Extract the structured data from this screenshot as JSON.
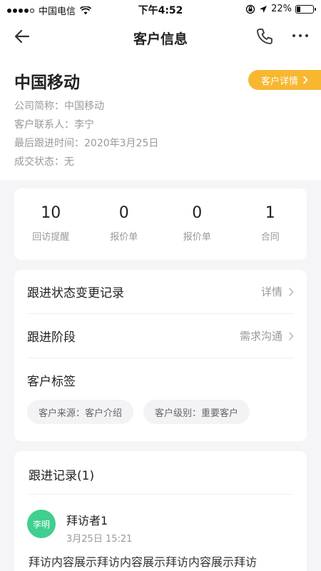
{
  "status_bar": {
    "carrier": "中国电信",
    "time": "下午4:52",
    "battery": "22%",
    "battery_level": 0.22
  },
  "nav": {
    "title": "客户信息"
  },
  "customer": {
    "name": "中国移动",
    "detail_button": "客户详情",
    "short_name": "公司简称：中国移动",
    "contact": "客户联系人：李宁",
    "last_follow": "最后跟进时间：2020年3月25日",
    "deal_status": "成交状态：无"
  },
  "stats": [
    {
      "value": "10",
      "label": "回访提醒"
    },
    {
      "value": "0",
      "label": "报价单"
    },
    {
      "value": "0",
      "label": "报价单"
    },
    {
      "value": "1",
      "label": "合同"
    }
  ],
  "follow": {
    "status_record_title": "跟进状态变更记录",
    "status_record_action": "详情",
    "stage_title": "跟进阶段",
    "stage_value": "需求沟通",
    "tags_title": "客户标签",
    "tags": [
      "客户来源：客户介绍",
      "客户级别：重要客户"
    ]
  },
  "records": {
    "title": "跟进记录(1)",
    "items": [
      {
        "avatar_text": "李明",
        "visitor": "拜访者1",
        "time": "3月25日 15:21",
        "content": "拜访内容展示拜访内容展示拜访内容展示拜访"
      }
    ]
  },
  "colors": {
    "accent": "#f7b731",
    "avatar": "#3fcf8e"
  }
}
